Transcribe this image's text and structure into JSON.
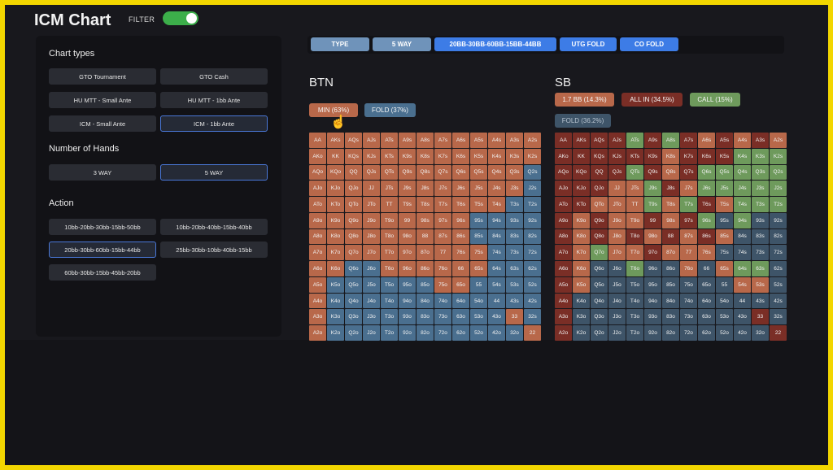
{
  "header": {
    "title": "ICM Chart",
    "filter_label": "FILTER",
    "filter_on": true
  },
  "left_panel": {
    "chart_types_title": "Chart types",
    "chart_types": [
      {
        "label": "GTO Tournament",
        "active": false
      },
      {
        "label": "GTO Cash",
        "active": false
      },
      {
        "label": "HU MTT - Small Ante",
        "active": false
      },
      {
        "label": "HU MTT - 1bb Ante",
        "active": false
      },
      {
        "label": "ICM - Small Ante",
        "active": false
      },
      {
        "label": "ICM - 1bb Ante",
        "active": true
      }
    ],
    "hands_title": "Number of Hands",
    "hands": [
      {
        "label": "3 WAY",
        "active": false
      },
      {
        "label": "5 WAY",
        "active": true
      }
    ],
    "action_title": "Action",
    "actions": [
      {
        "label": "10bb-20bb-30bb-15bb-50bb",
        "active": false
      },
      {
        "label": "10bb-20bb-40bb-15bb-40bb",
        "active": false
      },
      {
        "label": "20bb-30bb-60bb-15bb-44bb",
        "active": true
      },
      {
        "label": "25bb-30bb-10bb-40bb-15bb",
        "active": false
      },
      {
        "label": "60bb-30bb-15bb-45bb-20bb",
        "active": false
      }
    ]
  },
  "filters": [
    {
      "label": "TYPE",
      "color": "#6f93ba"
    },
    {
      "label": "5 WAY",
      "color": "#6f93ba"
    },
    {
      "label": "20BB-30BB-60BB-15BB-44BB",
      "color": "#3d7ce6"
    },
    {
      "label": "UTG FOLD",
      "color": "#3d7ce6"
    },
    {
      "label": "CO FOLD",
      "color": "#3d7ce6"
    }
  ],
  "btn": {
    "title": "BTN",
    "legend": [
      {
        "label": "MIN (63%)",
        "color": "#b8684a"
      },
      {
        "label": "FOLD (37%)",
        "color": "#4a6f8f"
      }
    ]
  },
  "sb": {
    "title": "SB",
    "legend": [
      {
        "label": "1.7 BB (14.3%)",
        "color": "#b8684a"
      },
      {
        "label": "ALL IN (34.5%)",
        "color": "#7a2e26"
      },
      {
        "label": "CALL (15%)",
        "color": "#6e9a5c"
      },
      {
        "label": "FOLD (36.2%)",
        "color": "#3e5468"
      }
    ]
  },
  "colors": {
    "raise": "#b8684a",
    "fold": "#4a6f8f",
    "allin": "#7a2e26",
    "call": "#6e9a5c",
    "sbfold": "#3e5468"
  },
  "btn_rows": [
    "RRRRRRRRRRRRR",
    "RRRRRRRRRRRRR",
    "RRRRRRRRRRRRF",
    "RRRRRRRRRRRRF",
    "RRRRRRRRRRRFF",
    "RRRRRRRRRFFFF",
    "RRRRRRRRRFFFF",
    "RRRRRRRRRRFFF",
    "RRFFRRRRRRFFF",
    "RFFFFFFRRFFFF",
    "RFFFFFFFFFFFF",
    "RFFFFFFFFFFRF",
    "RFFFFFFFFFFFR"
  ],
  "sb_rows": [
    "AAAACACARARAR",
    "AAAAAARAAACCC",
    "AAAACARACCCCC",
    "AAARRCARCCCCC",
    "AARRRCRCARCCC",
    "ARARRARACFCFF",
    "ARARARARARFFF",
    "ARCRRARRRFFFF",
    "ARFFCFFRFRCCF",
    "ARFFFFFFFFRRF",
    "AFFFFFFFFFFFF",
    "AFFFFFFFFFFAF",
    "AFFFFFFFFFFFA"
  ]
}
